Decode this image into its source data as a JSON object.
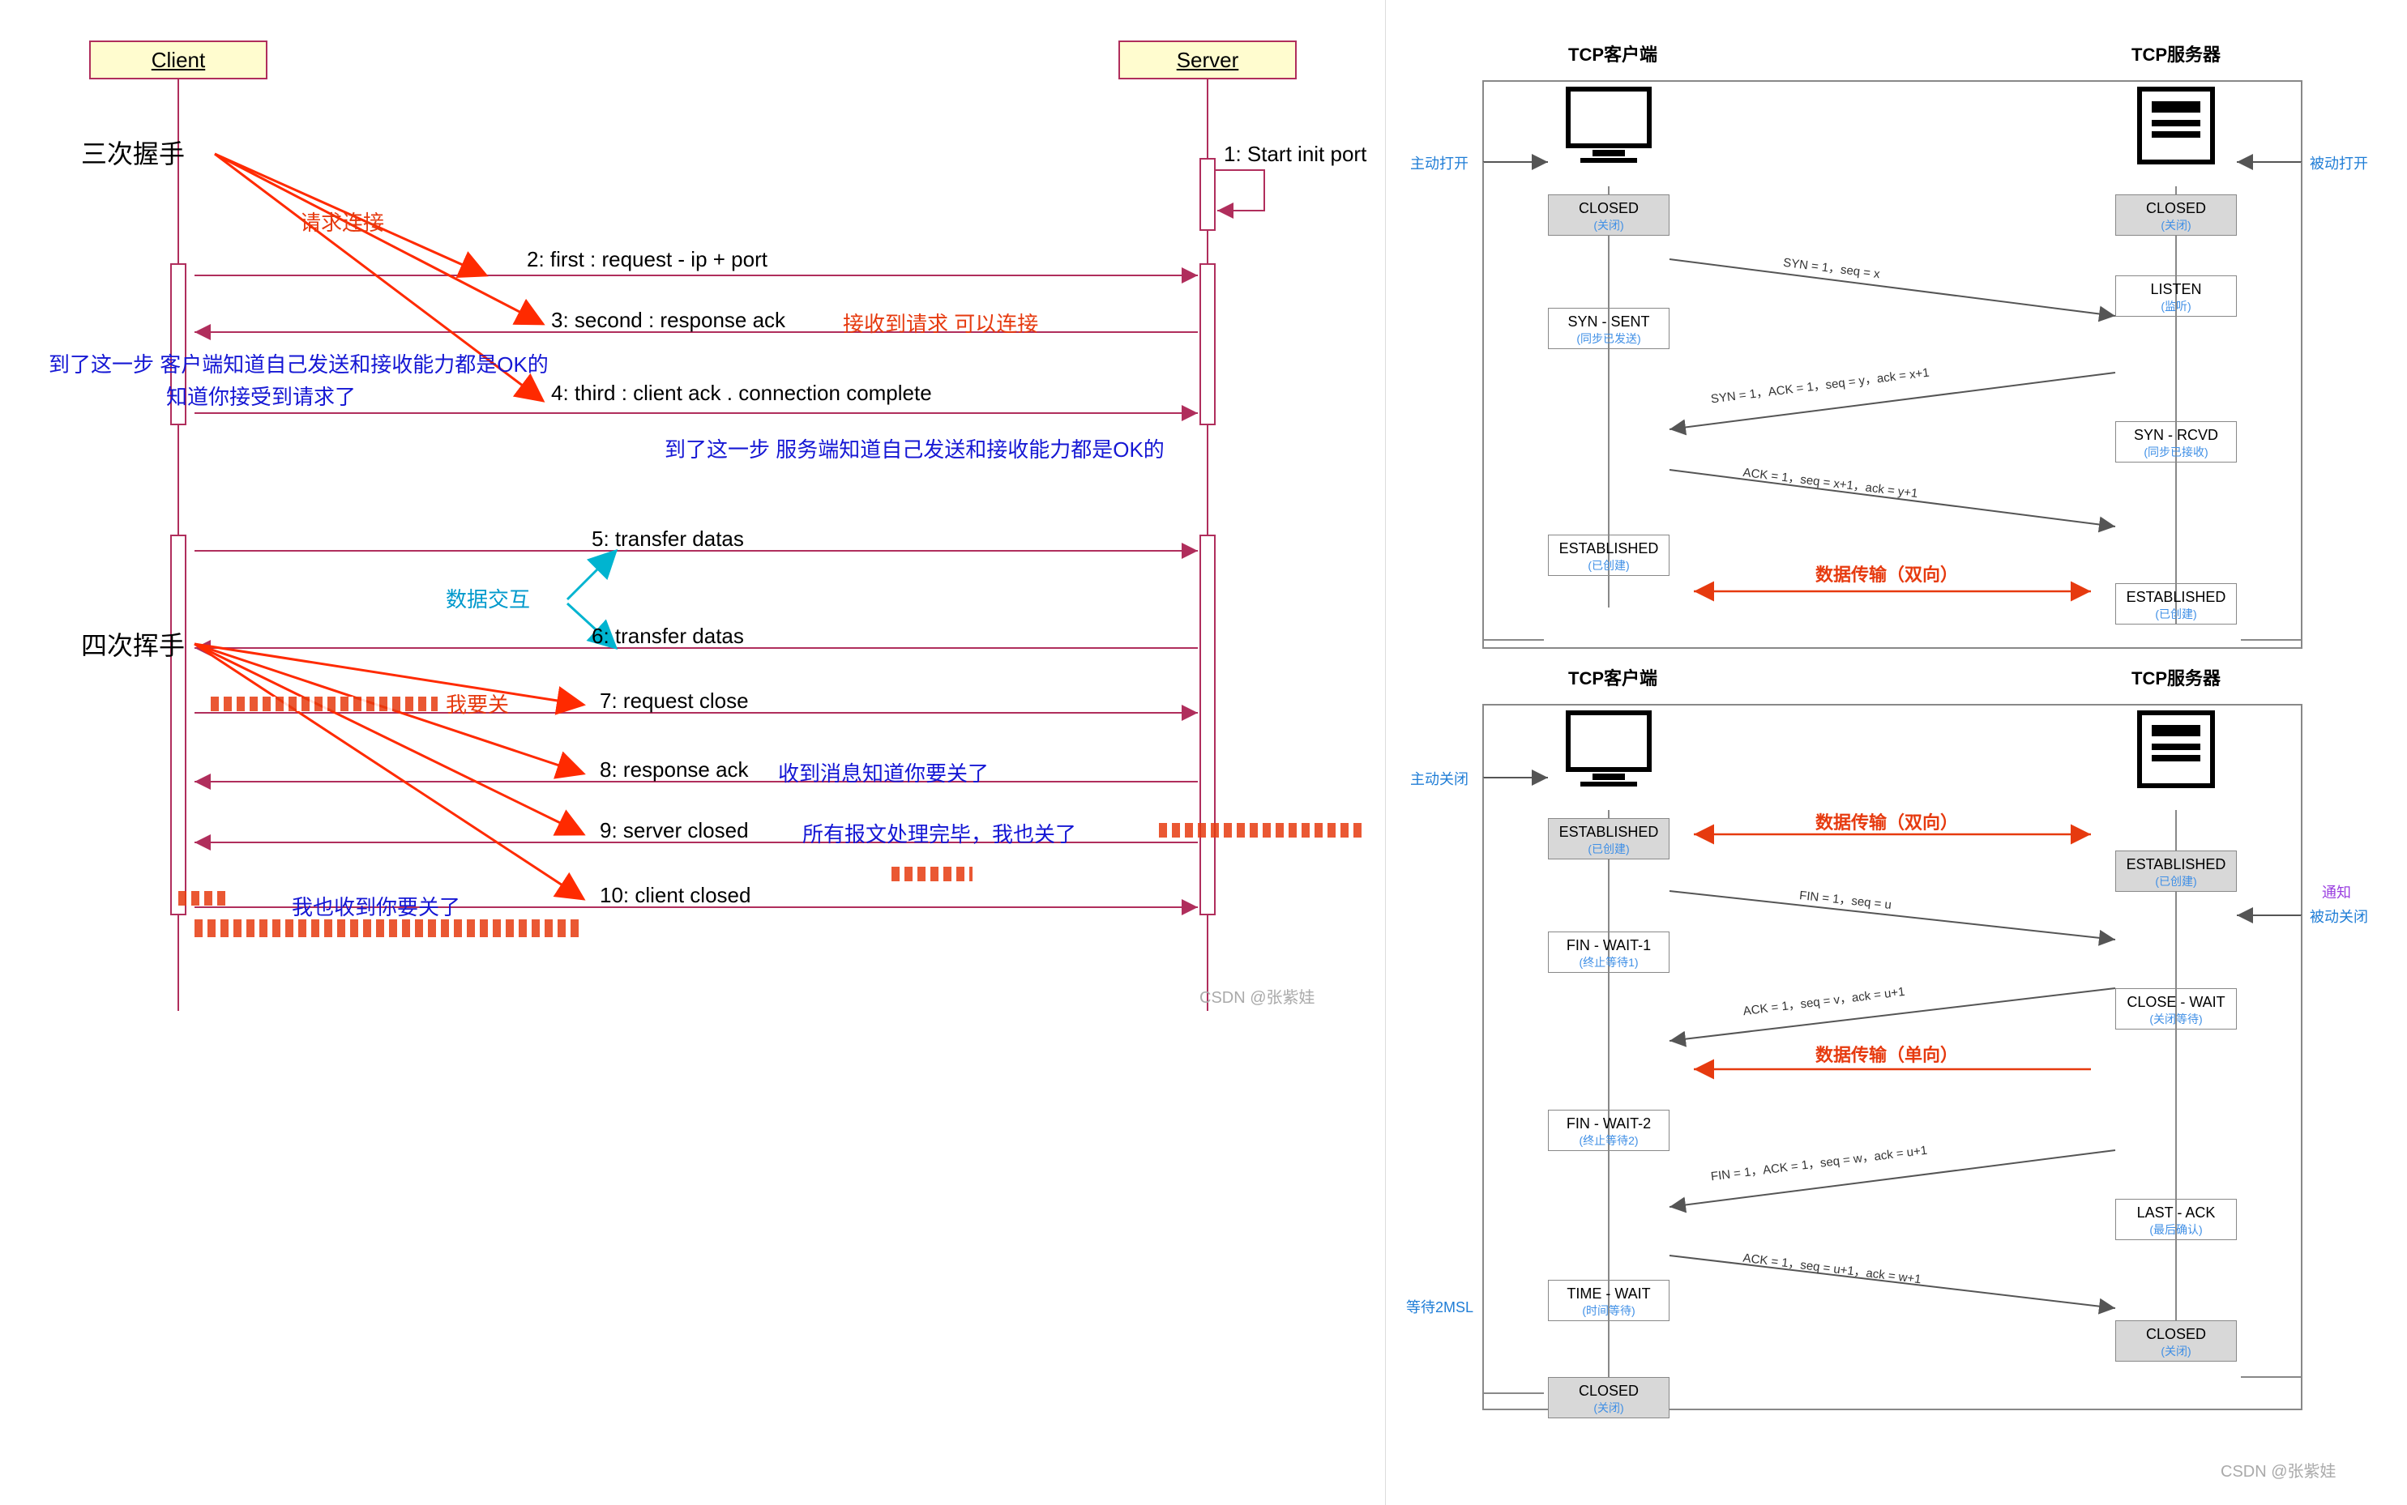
{
  "left": {
    "client_label": "Client",
    "server_label": "Server",
    "three_way": "三次握手",
    "four_way": "四次挥手",
    "request_connect": "请求连接",
    "data_exchange": "数据交互",
    "i_want_close": "我要关",
    "know_you_accept": "知道你接受到请求了",
    "messages": {
      "m1": "1: Start init port",
      "m2": "2: first : request - ip + port",
      "m3": "3: second : response ack",
      "m3r": "接收到请求 可以连接",
      "m4": "4: third : client ack . connection complete",
      "m4b": "到了这一步 客户端知道自己发送和接收能力都是OK的",
      "m4_after": "到了这一步 服务端知道自己发送和接收能力都是OK的",
      "m5": "5: transfer datas",
      "m6": "6: transfer datas",
      "m7": "7: request close",
      "m8": "8: response ack",
      "m8r": "收到消息知道你要关了",
      "m9": "9: server closed",
      "m9r": "所有报文处理完毕，我也关了",
      "m10": "10: client closed",
      "m10r": "我也收到你要关了"
    },
    "watermark": "CSDN @张紫娃"
  },
  "right": {
    "client_hdr": "TCP客户端",
    "server_hdr": "TCP服务器",
    "active_open": "主动打开",
    "passive_open": "被动打开",
    "active_close": "主动关闭",
    "passive_close": "被动关闭",
    "notify": "通知",
    "wait2msl": "等待2MSL",
    "flow_bi": "数据传输（双向）",
    "flow_uni": "数据传输（单向）",
    "states": {
      "closed": "CLOSED",
      "closed_sub": "(关闭)",
      "listen": "LISTEN",
      "listen_sub": "(监听)",
      "synsent": "SYN - SENT",
      "synsent_sub": "(同步已发送)",
      "synrcvd": "SYN - RCVD",
      "synrcvd_sub": "(同步已接收)",
      "estab": "ESTABLISHED",
      "estab_sub": "(已创建)",
      "finw1": "FIN - WAIT-1",
      "finw1_sub": "(终止等待1)",
      "finw2": "FIN - WAIT-2",
      "finw2_sub": "(终止等待2)",
      "closew": "CLOSE - WAIT",
      "closew_sub": "(关闭等待)",
      "lastack": "LAST - ACK",
      "lastack_sub": "(最后确认)",
      "timew": "TIME - WAIT",
      "timew_sub": "(时间等待)"
    },
    "msgs": {
      "syn": "SYN = 1，seq = x",
      "synack": "SYN = 1，ACK = 1，seq = y，ack = x+1",
      "ack1": "ACK = 1，seq = x+1，ack = y+1",
      "fin": "FIN = 1，seq = u",
      "ack2": "ACK = 1，seq = v，ack = u+1",
      "fin2": "FIN = 1，ACK = 1，seq = w，ack = u+1",
      "ack3": "ACK = 1，seq = u+1，ack = w+1"
    },
    "watermark": "CSDN @张紫娃"
  }
}
